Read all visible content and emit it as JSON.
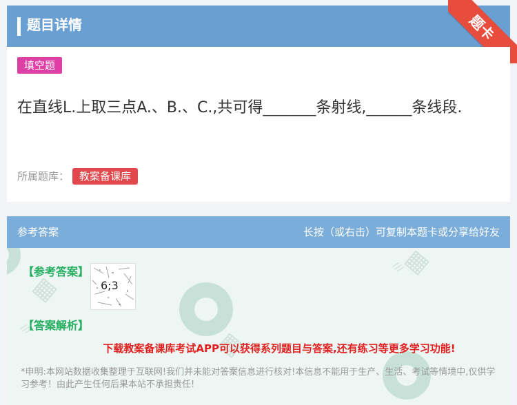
{
  "header": {
    "title": "题目详情",
    "ribbon_label": "题卡"
  },
  "question": {
    "type_tag": "填空题",
    "text": "在直线L.上取三点A.、B.、C.,共可得_______条射线,______条线段.",
    "library_label": "所属题库：",
    "library_tag": "教案备课库"
  },
  "answer": {
    "header_left": "参考答案",
    "header_right": "长按（或右击）可复制本题卡或分享给好友",
    "ref_label": "【参考答案】",
    "ref_value": "6;3",
    "explain_label": "【答案解析】",
    "promo": "下载教案备课库考试APP可以获得系列题目与答案,还有练习等更多学习功能!",
    "disclaimer": "*申明:本网站数据收集整理于互联网!我们并未能对答案信息进行核对!本信息不能用于生产、生活、考试等情境中,仅供学习参考！由此产生任何后果本站不承担责任!"
  },
  "colors": {
    "header_bg": "#6a9fd2",
    "ribbon": "#e74c3c",
    "type_tag": "#de3fa7",
    "library_tag": "#e1484b",
    "answer_header": "#7aadd9",
    "answer_bg": "#eef6f4",
    "label_green": "#27ae60",
    "promo_red": "#e02020"
  }
}
